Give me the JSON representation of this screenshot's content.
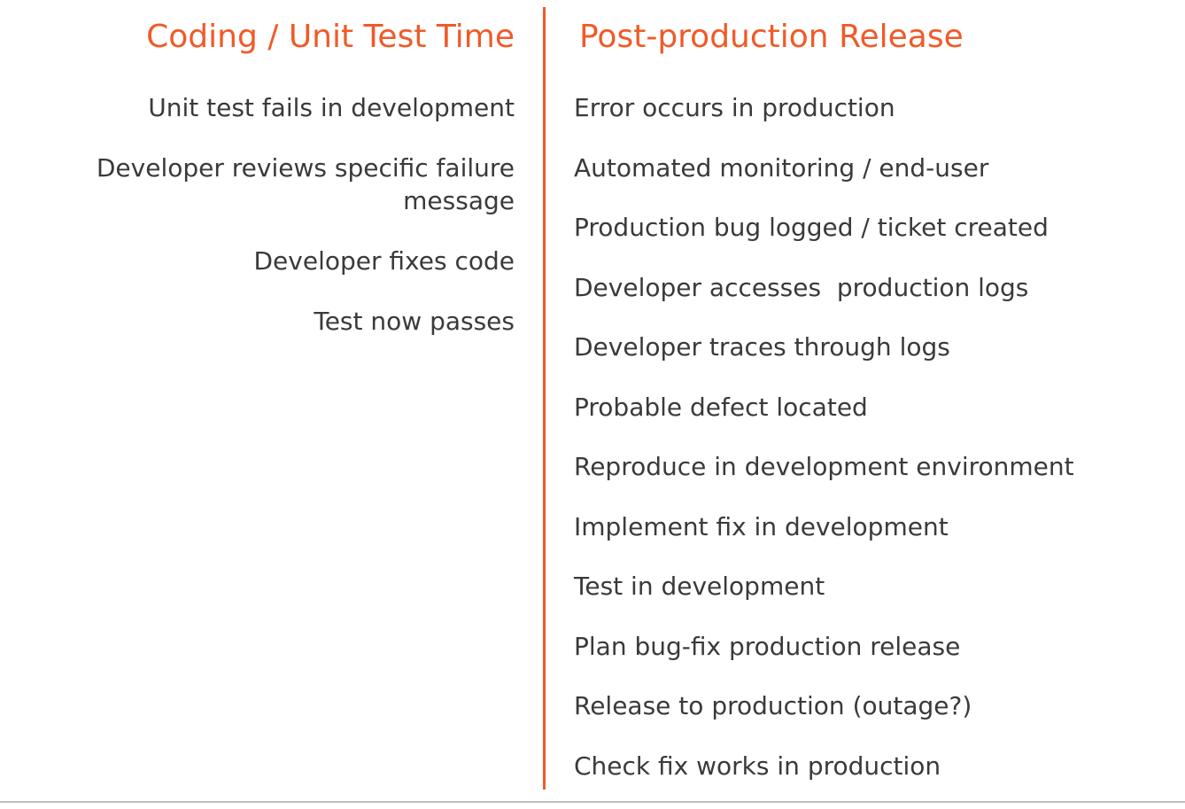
{
  "colors": {
    "accent": "#f05a28",
    "text": "#3a3a3a"
  },
  "left": {
    "heading": "Coding / Unit Test Time",
    "items": [
      "Unit test fails in development",
      "Developer reviews specific failure message",
      "Developer fixes code",
      "Test now passes"
    ]
  },
  "right": {
    "heading": "Post-production Release",
    "items": [
      "Error occurs in production",
      "Automated monitoring / end-user",
      "Production bug logged / ticket created",
      "Developer accesses  production logs",
      "Developer traces through logs",
      "Probable defect located",
      "Reproduce in development environment",
      "Implement fix in development",
      "Test in development",
      "Plan bug-fix production release",
      "Release to production (outage?)",
      "Check fix works in production"
    ]
  }
}
